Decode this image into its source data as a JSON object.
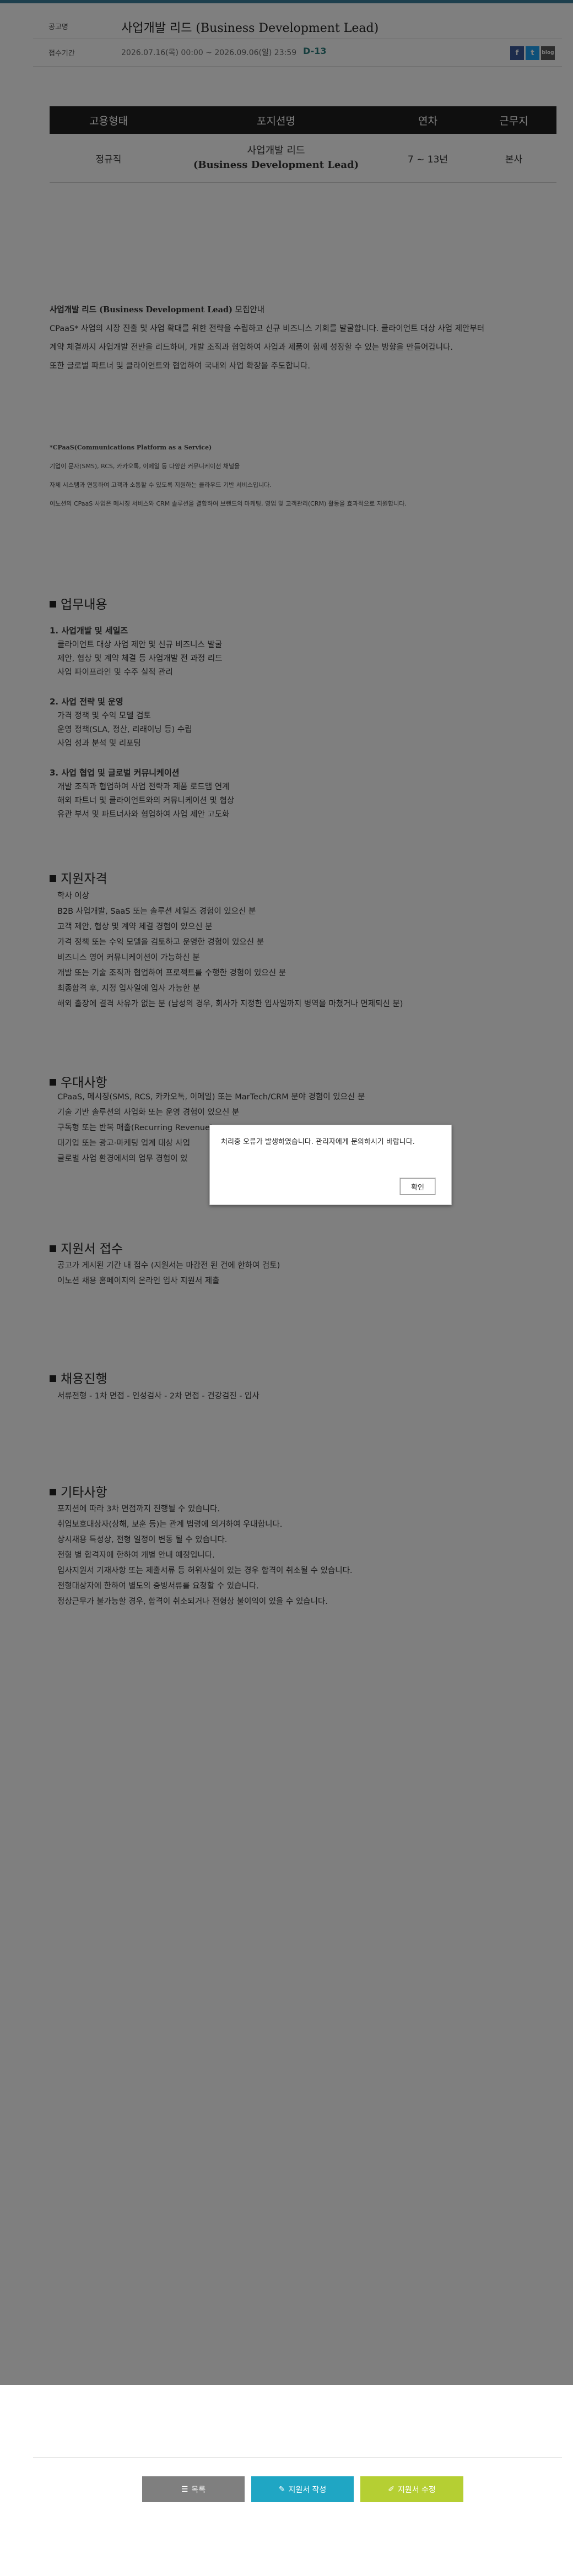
{
  "header": {
    "title_label": "공고명",
    "title": "사업개발 리드 (Business Development Lead)",
    "period_label": "접수기간",
    "period": "2026.07.16(목) 00:00 ~ 2026.09.06(일) 23:59",
    "dday": "D-13",
    "share_facebook": "f",
    "share_twitter": "t",
    "share_blog": "blog"
  },
  "job_table": {
    "headers": [
      "고용형태",
      "포지션명",
      "연차",
      "근무지"
    ],
    "employment": "정규직",
    "position_ko": "사업개발 리드",
    "position_en": "(Business Development Lead)",
    "years": "7 ~ 13년",
    "location": "본사"
  },
  "intro": {
    "line1_bold": "사업개발 리드 (Business Development Lead)",
    "line1_rest": " 모집안내",
    "line2": "CPaaS* 사업의 시장 진출 및 사업 확대를 위한 전략을 수립하고 신규 비즈니스 기회를 발굴합니다. 클라이언트 대상 사업 제안부터",
    "line3": "계약 체결까지 사업개발 전반을 리드하며, 개발 조직과 협업하여 사업과 제품이 함께 성장할 수 있는 방향을 만들어갑니다.",
    "line4": "또한 글로벌 파트너 및 클라이언트와 협업하여 국내외 사업 확장을 주도합니다."
  },
  "footnote": {
    "heading": "*CPaaS(Communications Platform as a Service)",
    "line1": "기업이 문자(SMS), RCS, 카카오톡, 이메일 등 다양한 커뮤니케이션 채널을",
    "line2": "자체 시스템과 연동하여 고객과 소통할 수 있도록 지원하는 클라우드 기반 서비스입니다.",
    "line3": "이노션의 CPaaS 사업은 메시징 서비스와 CRM 솔루션을 결합하여 브랜드의 마케팅, 영업 및 고객관리(CRM) 활동을 효과적으로 지원합니다."
  },
  "duties": {
    "title": "업무내용",
    "groups": [
      {
        "heading": "1. 사업개발 및 세일즈",
        "items": [
          "클라이언트 대상 사업 제안 및 신규 비즈니스 발굴",
          "제안, 협상 및 계약 체결 등 사업개발 전 과정 리드",
          "사업 파이프라인 및 수주 실적 관리"
        ]
      },
      {
        "heading": "2. 사업 전략 및 운영",
        "items": [
          "가격 정책 및 수익 모델 검토",
          "운영 정책(SLA, 정산, 리래이닝 등) 수립",
          "사업 성과 분석 및 리포팅"
        ]
      },
      {
        "heading": "3. 사업 협업 및 글로벌 커뮤니케이션",
        "items": [
          "개발 조직과 협업하여 사업 전략과 제품 로드맵 연계",
          "해외 파트너 및 클라이언트와의 커뮤니케이션 및 협상",
          "유관 부서 및 파트너사와 협업하여 사업 제안 고도화"
        ]
      }
    ]
  },
  "qualifications": {
    "title": "지원자격",
    "items": [
      "학사 이상",
      "B2B 사업개발, SaaS 또는 솔루션 세일즈 경험이 있으신 분",
      "고객 제안, 협상 및 계약 체결 경험이 있으신 분",
      "가격 정책 또는 수익 모델을 검토하고 운영한 경험이 있으신 분",
      "비즈니스 영어 커뮤니케이션이 가능하신 분",
      "개발 또는 기술 조직과 협업하여 프로젝트를 수행한 경험이 있으신 분",
      "최종합격 후, 지정 입사일에 입사 가능한 분",
      "해외 출장에 결격 사유가 없는 분 (남성의 경우, 회사가 지정한 입사일까지 병역을 마쳤거나 면제되신 분)"
    ]
  },
  "preferred": {
    "title": "우대사항",
    "items": [
      "CPaaS, 메시징(SMS, RCS, 카카오톡, 이메일) 또는 MarTech/CRM 분야 경험이 있으신 분",
      "기술 기반 솔루션의 사업화 또는 운영 경험이 있으신 분",
      "구독형 또는 반복 매출(Recurring Revenue)",
      "대기업 또는 광고·마케팅 업계 대상 사업",
      "글로벌 사업 환경에서의 업무 경험이 있"
    ]
  },
  "apply": {
    "title": "지원서 접수",
    "items": [
      "공고가 게시된 기간 내 접수 (지원서는 마감전 된 건에 한하여 검토)",
      "이노션 채용 홈페이지의 온라인 입사 지원서 제출"
    ]
  },
  "process": {
    "title": "채용진행",
    "items": [
      "서류전형 - 1차 면접 - 인성검사 - 2차 면접 - 건강검진 - 입사"
    ]
  },
  "etc": {
    "title": "기타사항",
    "items": [
      "포지션에 따라 3차 면접까지 진행될 수 있습니다.",
      "취업보호대상자(상해, 보훈 등)는 관계 법령에 의거하여 우대합니다.",
      "상시채용 특성상, 전형 일정이 변동 될 수 있습니다.",
      "전형 별 합격자에 한하여 개별 안내 예정입니다.",
      "입사지원서 기재사항 또는 제출서류 등 허위사실이 있는 경우 합격이 취소될 수 있습니다.",
      "전형대상자에 한하여 별도의 증빙서류를 요청할 수 있습니다.",
      "정상근무가 불가능할 경우, 합격이 취소되거나 전형상 불이익이 있을 수 있습니다."
    ]
  },
  "dialog": {
    "message": "처리중 오류가 발생하였습니다. 관리자에게 문의하시기 바랍니다.",
    "ok_label": "확인"
  },
  "footer": {
    "list_label": "목록",
    "write_label": "지원서 작성",
    "edit_label": "지원서 수정"
  },
  "colors": {
    "accent_teal": "#1fa6c4",
    "accent_lime": "#b5cf33",
    "gray_button": "#7f7f7f",
    "dday": "#2a7a7a"
  }
}
